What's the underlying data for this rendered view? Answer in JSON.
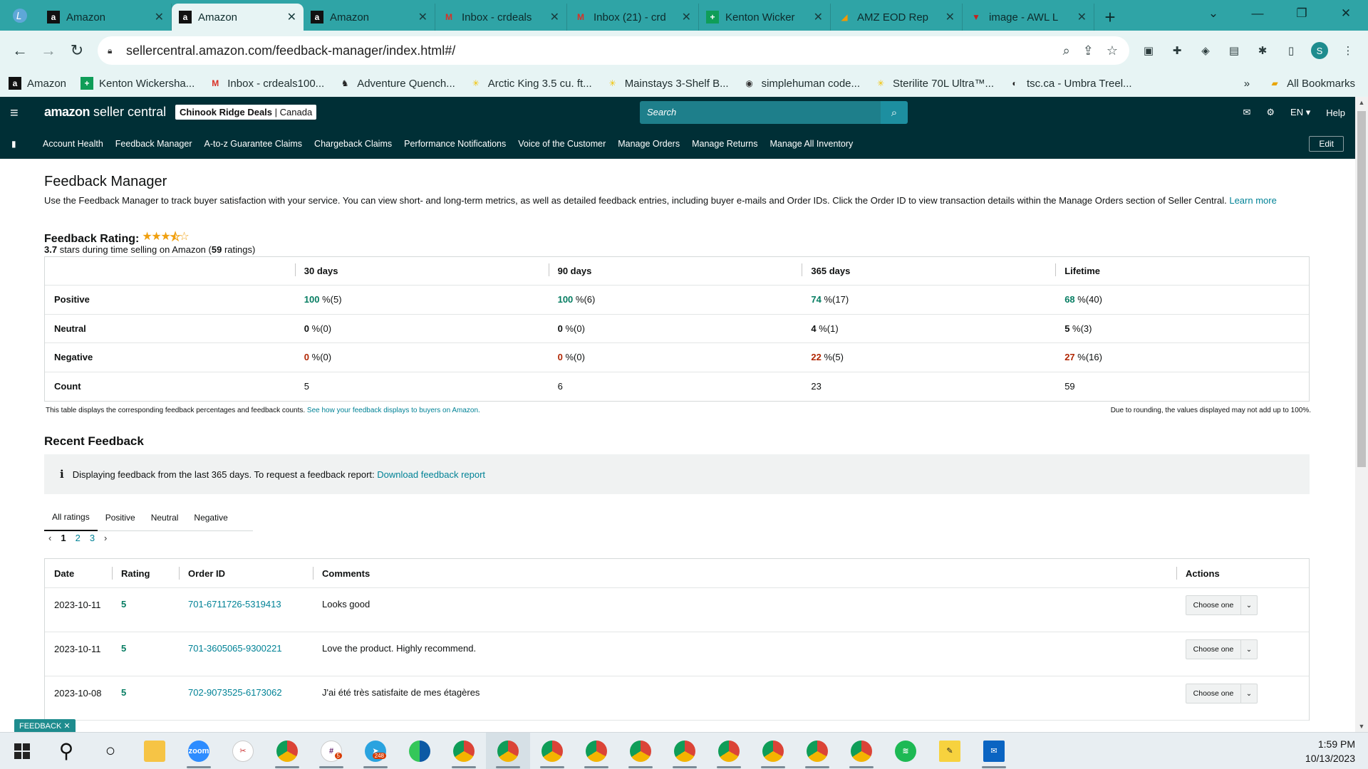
{
  "browser": {
    "tabs": [
      {
        "title": "Amazon",
        "active": false
      },
      {
        "title": "Amazon",
        "active": true
      },
      {
        "title": "Amazon",
        "active": false
      },
      {
        "title": "Inbox - crdeals",
        "active": false
      },
      {
        "title": "Inbox (21) - crd",
        "active": false
      },
      {
        "title": "Kenton Wicker",
        "active": false
      },
      {
        "title": "AMZ EOD Rep",
        "active": false
      },
      {
        "title": "image - AWL L",
        "active": false
      }
    ],
    "url": "sellercentral.amazon.com/feedback-manager/index.html#/",
    "bookmarks": [
      "Amazon",
      "Kenton Wickersha...",
      "Inbox - crdeals100...",
      "Adventure Quench...",
      "Arctic King 3.5 cu. ft...",
      "Mainstays 3-Shelf B...",
      "simplehuman code...",
      "Sterilite 70L Ultra™...",
      "tsc.ca - Umbra Treel..."
    ],
    "all_bookmarks": "All Bookmarks",
    "profile_initial": "S"
  },
  "sc": {
    "logo_a": "amazon",
    "logo_b": " seller central",
    "store_name": "Chinook Ridge Deals",
    "store_region": "Canada",
    "search_placeholder": "Search",
    "lang": "EN",
    "help": "Help",
    "nav": [
      "Account Health",
      "Feedback Manager",
      "A-to-z Guarantee Claims",
      "Chargeback Claims",
      "Performance Notifications",
      "Voice of the Customer",
      "Manage Orders",
      "Manage Returns",
      "Manage All Inventory"
    ],
    "edit": "Edit"
  },
  "page": {
    "title": "Feedback Manager",
    "intro": "Use the Feedback Manager to track buyer satisfaction with your service. You can view short- and long-term metrics, as well as detailed feedback entries, including buyer e-mails and Order IDs. Click the Order ID to view transaction details within the Manage Orders section of Seller Central.",
    "learn_more": "Learn more",
    "rating_label": "Feedback Rating:",
    "stars_value": 3.7,
    "rating_value": "3.7",
    "rating_text_a": " stars during time selling on Amazon (",
    "rating_count": "59",
    "rating_text_b": " ratings)",
    "summary": {
      "columns": [
        "30 days",
        "90 days",
        "365 days",
        "Lifetime"
      ],
      "rows": [
        {
          "label": "Positive",
          "cells": [
            [
              "100",
              "%(5)"
            ],
            [
              "100",
              "%(6)"
            ],
            [
              "74",
              "%(17)"
            ],
            [
              "68",
              "%(40)"
            ]
          ]
        },
        {
          "label": "Neutral",
          "cells": [
            [
              "0",
              "%(0)"
            ],
            [
              "0",
              "%(0)"
            ],
            [
              "4",
              "%(1)"
            ],
            [
              "5",
              "%(3)"
            ]
          ]
        },
        {
          "label": "Negative",
          "cells": [
            [
              "0",
              "%(0)"
            ],
            [
              "0",
              "%(0)"
            ],
            [
              "22",
              "%(5)"
            ],
            [
              "27",
              "%(16)"
            ]
          ]
        },
        {
          "label": "Count",
          "cells": [
            [
              "5",
              ""
            ],
            [
              "6",
              ""
            ],
            [
              "23",
              ""
            ],
            [
              "59",
              ""
            ]
          ]
        }
      ],
      "note": "This table displays the corresponding feedback percentages and feedback counts.",
      "note_link": "See how your feedback displays to buyers on Amazon.",
      "note_right": "Due to rounding, the values displayed may not add up to 100%."
    },
    "recent_title": "Recent Feedback",
    "info_text": "Displaying feedback from the last 365 days. To request a feedback report:",
    "info_link": "Download feedback report",
    "filter_tabs": [
      "All ratings",
      "Positive",
      "Neutral",
      "Negative"
    ],
    "pages": [
      "1",
      "2",
      "3"
    ],
    "table_headers": [
      "Date",
      "Rating",
      "Order ID",
      "Comments",
      "Actions"
    ],
    "feedback": [
      {
        "date": "2023-10-11",
        "rating": "5",
        "order": "701-6711726-5319413",
        "comment": "Looks good"
      },
      {
        "date": "2023-10-11",
        "rating": "5",
        "order": "701-3605065-9300221",
        "comment": "Love the product. Highly recommend."
      },
      {
        "date": "2023-10-08",
        "rating": "5",
        "order": "702-9073525-6173062",
        "comment": "J'ai été très satisfaite de mes étagères"
      }
    ],
    "choose_one": "Choose one",
    "feedback_pill": "FEEDBACK ✕"
  },
  "taskbar": {
    "time": "1:59 PM",
    "date": "10/13/2023"
  },
  "colors": {
    "header": "#002f36",
    "positive": "#067d62",
    "negative": "#b12704",
    "link": "#008296",
    "chrome": "#2fa4a6"
  }
}
